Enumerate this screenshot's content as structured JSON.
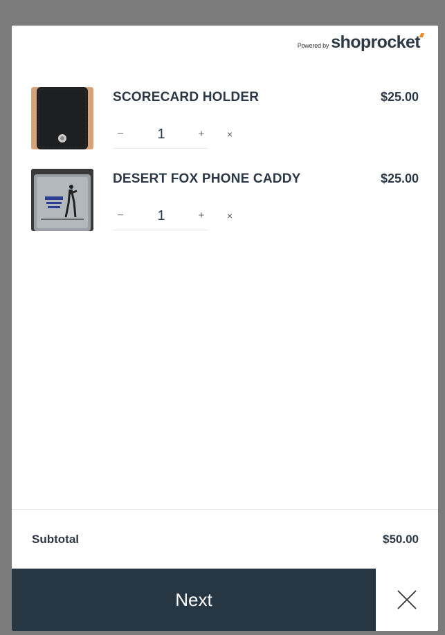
{
  "branding": {
    "powered_by": "Powered by",
    "brand_name": "shoprocket"
  },
  "cart": {
    "items": [
      {
        "name": "SCORECARD HOLDER",
        "price": "$25.00",
        "quantity": "1",
        "decrement": "−",
        "increment": "+",
        "remove": "×",
        "thumbnail": "black leather scorecard holder"
      },
      {
        "name": "DESERT FOX PHONE CADDY",
        "price": "$25.00",
        "quantity": "1",
        "decrement": "−",
        "increment": "+",
        "remove": "×",
        "thumbnail": "grey phone caddy with golfer graphic"
      }
    ]
  },
  "summary": {
    "subtotal_label": "Subtotal",
    "subtotal_value": "$50.00"
  },
  "footer": {
    "next_label": "Next",
    "close_icon": "close-icon"
  },
  "colors": {
    "overlay": "#7b7b7b",
    "panel": "#ffffff",
    "text_dark": "#2b3744",
    "button_dark": "#263643",
    "brand_accent": "#f08a24"
  }
}
